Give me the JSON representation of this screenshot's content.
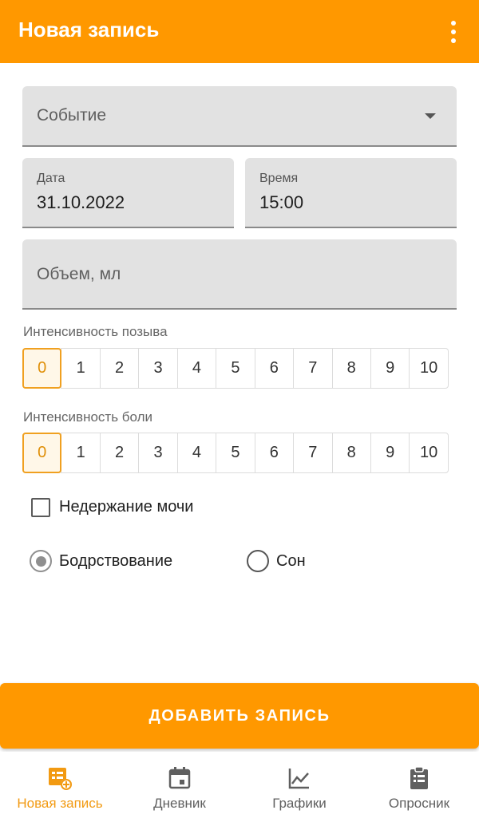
{
  "appbar": {
    "title": "Новая запись",
    "menu_icon": "more-vert-icon"
  },
  "form": {
    "event": {
      "placeholder": "Событие",
      "icon": "dropdown-arrow-icon"
    },
    "date": {
      "label": "Дата",
      "value": "31.10.2022"
    },
    "time": {
      "label": "Время",
      "value": "15:00"
    },
    "volume": {
      "placeholder": "Объем, мл"
    },
    "urge": {
      "label": "Интенсивность позыва",
      "options": [
        "0",
        "1",
        "2",
        "3",
        "4",
        "5",
        "6",
        "7",
        "8",
        "9",
        "10"
      ],
      "selected": "0"
    },
    "pain": {
      "label": "Интенсивность боли",
      "options": [
        "0",
        "1",
        "2",
        "3",
        "4",
        "5",
        "6",
        "7",
        "8",
        "9",
        "10"
      ],
      "selected": "0"
    },
    "incontinence": {
      "label": "Недержание мочи",
      "checked": false
    },
    "state": {
      "options": [
        "Бодрствование",
        "Сон"
      ],
      "selected": "Бодрствование"
    }
  },
  "add_button": {
    "label": "ДОБАВИТЬ ЗАПИСЬ"
  },
  "bottom_nav": {
    "items": [
      {
        "label": "Новая запись",
        "icon": "new-entry-icon",
        "active": true
      },
      {
        "label": "Дневник",
        "icon": "calendar-icon",
        "active": false
      },
      {
        "label": "Графики",
        "icon": "chart-icon",
        "active": false
      },
      {
        "label": "Опросник",
        "icon": "clipboard-icon",
        "active": false
      }
    ]
  },
  "colors": {
    "primary": "#FF9800",
    "active_nav": "#F29A12",
    "selected_cell_border": "#F0A020"
  }
}
